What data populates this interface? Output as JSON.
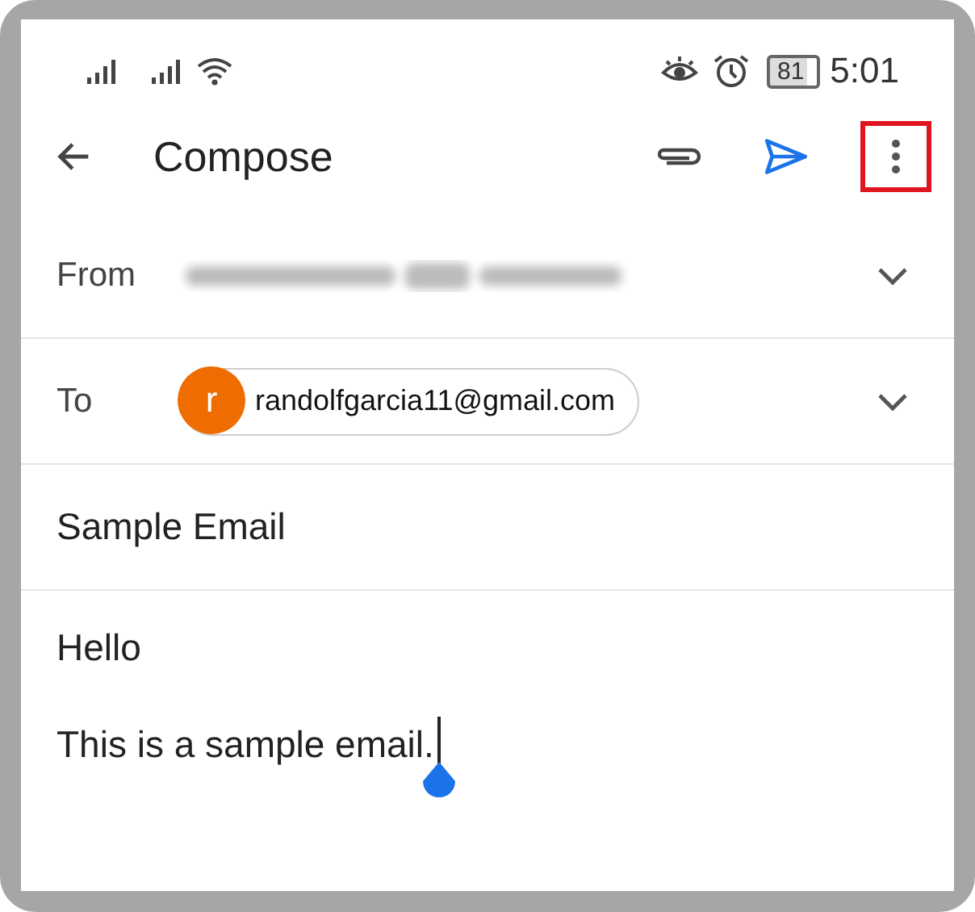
{
  "status_bar": {
    "battery": "81",
    "time": "5:01"
  },
  "toolbar": {
    "title": "Compose",
    "more_highlighted": true
  },
  "from": {
    "label": "From"
  },
  "to": {
    "label": "To",
    "recipient": {
      "initial": "r",
      "address": "randolfgarcia11@gmail.com",
      "color": "#ef6c00"
    }
  },
  "subject": "Sample Email",
  "body": [
    "Hello",
    "This is a sample email."
  ]
}
